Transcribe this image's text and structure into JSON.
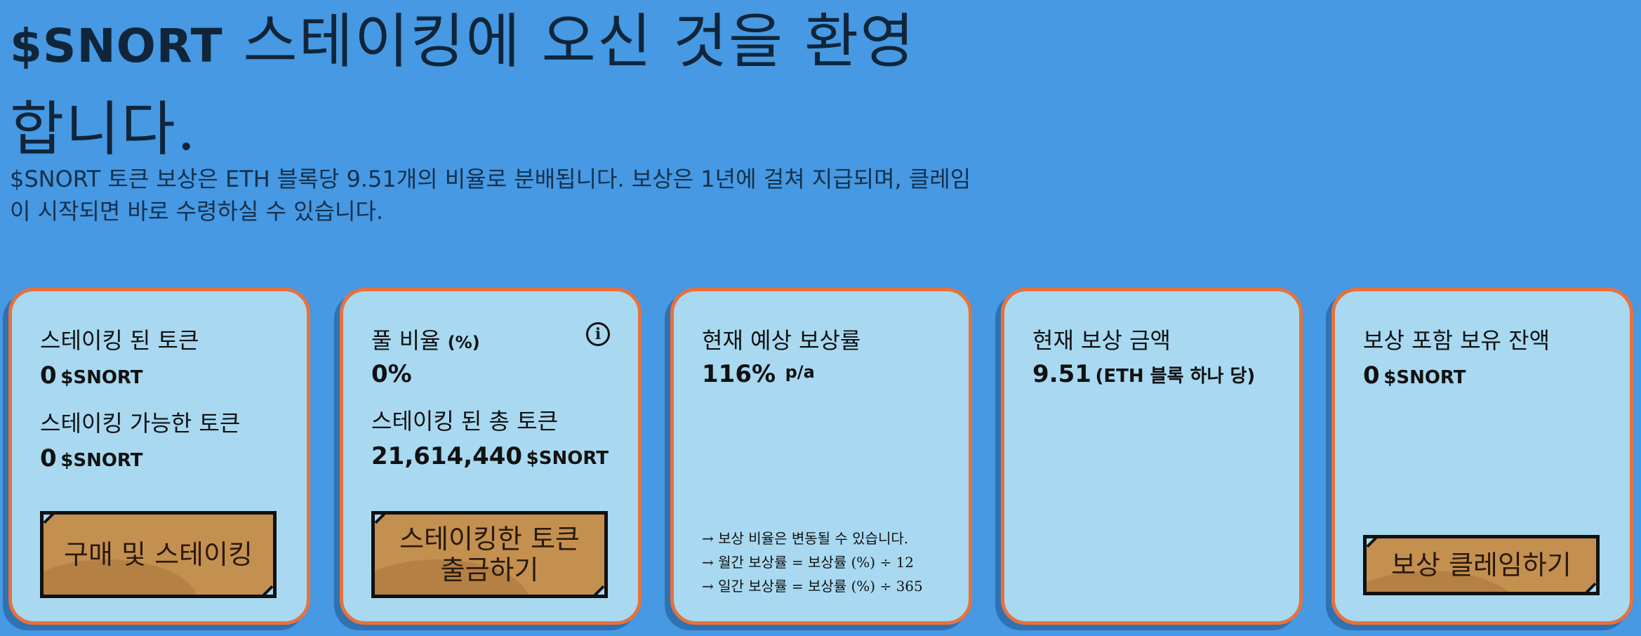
{
  "header": {
    "brand": "$SNORT",
    "title_rest": "스테이킹에 오신 것을 환영합니다.",
    "description": "$SNORT 토큰 보상은 ETH 블록당 9.51개의 비율로 분배됩니다. 보상은 1년에 걸쳐 지급되며, 클레임이 시작되면 바로 수령하실 수 있습니다."
  },
  "cards": {
    "staked": {
      "label1": "스테이킹 된 토큰",
      "value1": "0",
      "unit1": "$SNORT",
      "label2": "스테이킹 가능한 토큰",
      "value2": "0",
      "unit2": "$SNORT",
      "button": "구매 및 스테이킹"
    },
    "pool": {
      "label1": "풀 비율",
      "label1_unit": "(%)",
      "value1": "0%",
      "label2": "스테이킹 된 총 토큰",
      "value2": "21,614,440",
      "unit2": "$SNORT",
      "button": "스테이킹한 토큰 출금하기",
      "info_icon": "info-icon"
    },
    "apy": {
      "label": "현재 예상 보상률",
      "value": "116%",
      "unit": "p/a",
      "notes": [
        "→ 보상 비율은 변동될 수 있습니다.",
        "→ 월간 보상률 = 보상률 (%) ÷ 12",
        "→ 일간 보상률 = 보상률 (%) ÷ 365"
      ]
    },
    "reward": {
      "label": "현재 보상 금액",
      "value": "9.51",
      "unit": "(ETH 블록 하나 당)"
    },
    "balance": {
      "label": "보상 포함 보유 잔액",
      "value": "0",
      "unit": "$SNORT",
      "button": "보상 클레임하기"
    }
  },
  "colors": {
    "background": "#4699e2",
    "card": "#a8d9f1",
    "card_border": "#e8713c",
    "button": "#c4904f"
  }
}
